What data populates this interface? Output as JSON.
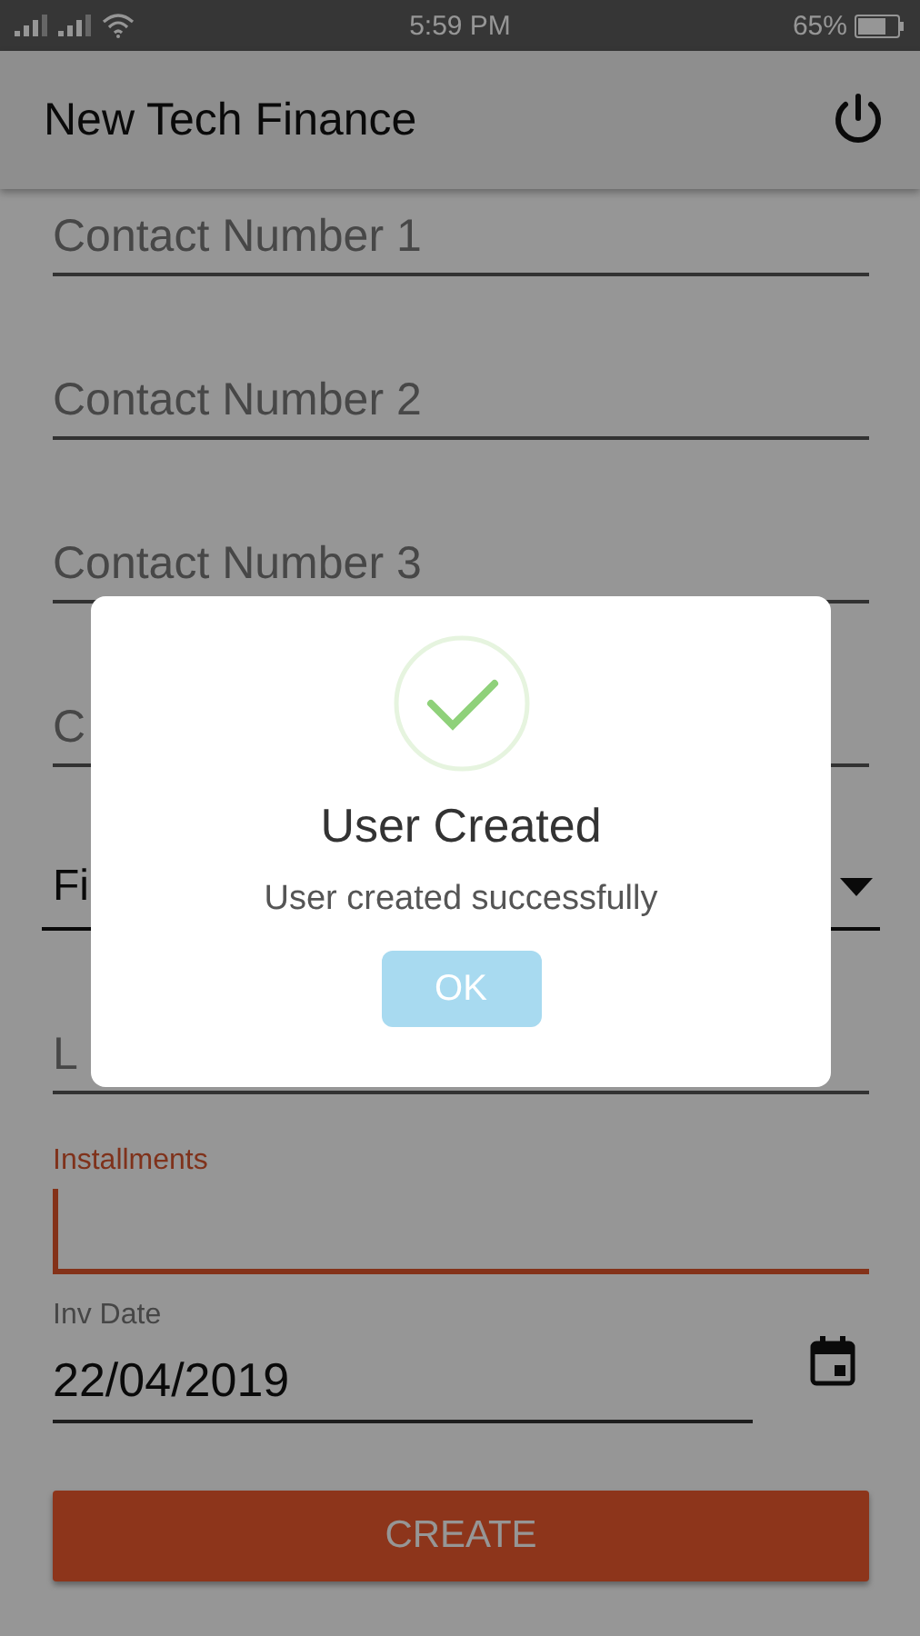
{
  "status_bar": {
    "time": "5:59 PM",
    "battery": "65%"
  },
  "app_bar": {
    "title": "New Tech Finance"
  },
  "fields": [
    {
      "kind": "text",
      "placeholder": "Contact Number 1"
    },
    {
      "kind": "text",
      "placeholder": "Contact Number 2"
    },
    {
      "kind": "text",
      "placeholder": "Contact Number 3"
    },
    {
      "kind": "text",
      "placeholder": "C"
    },
    {
      "kind": "dropdown",
      "value": "Fi"
    },
    {
      "kind": "text",
      "placeholder": "L"
    },
    {
      "kind": "labeled",
      "label": "Installments",
      "focused": true
    },
    {
      "kind": "date",
      "label": "Inv Date",
      "value": "22/04/2019",
      "focused": false
    }
  ],
  "create_button": "CREATE",
  "dialog": {
    "title": "User Created",
    "message": "User created successfully",
    "button": "OK"
  }
}
